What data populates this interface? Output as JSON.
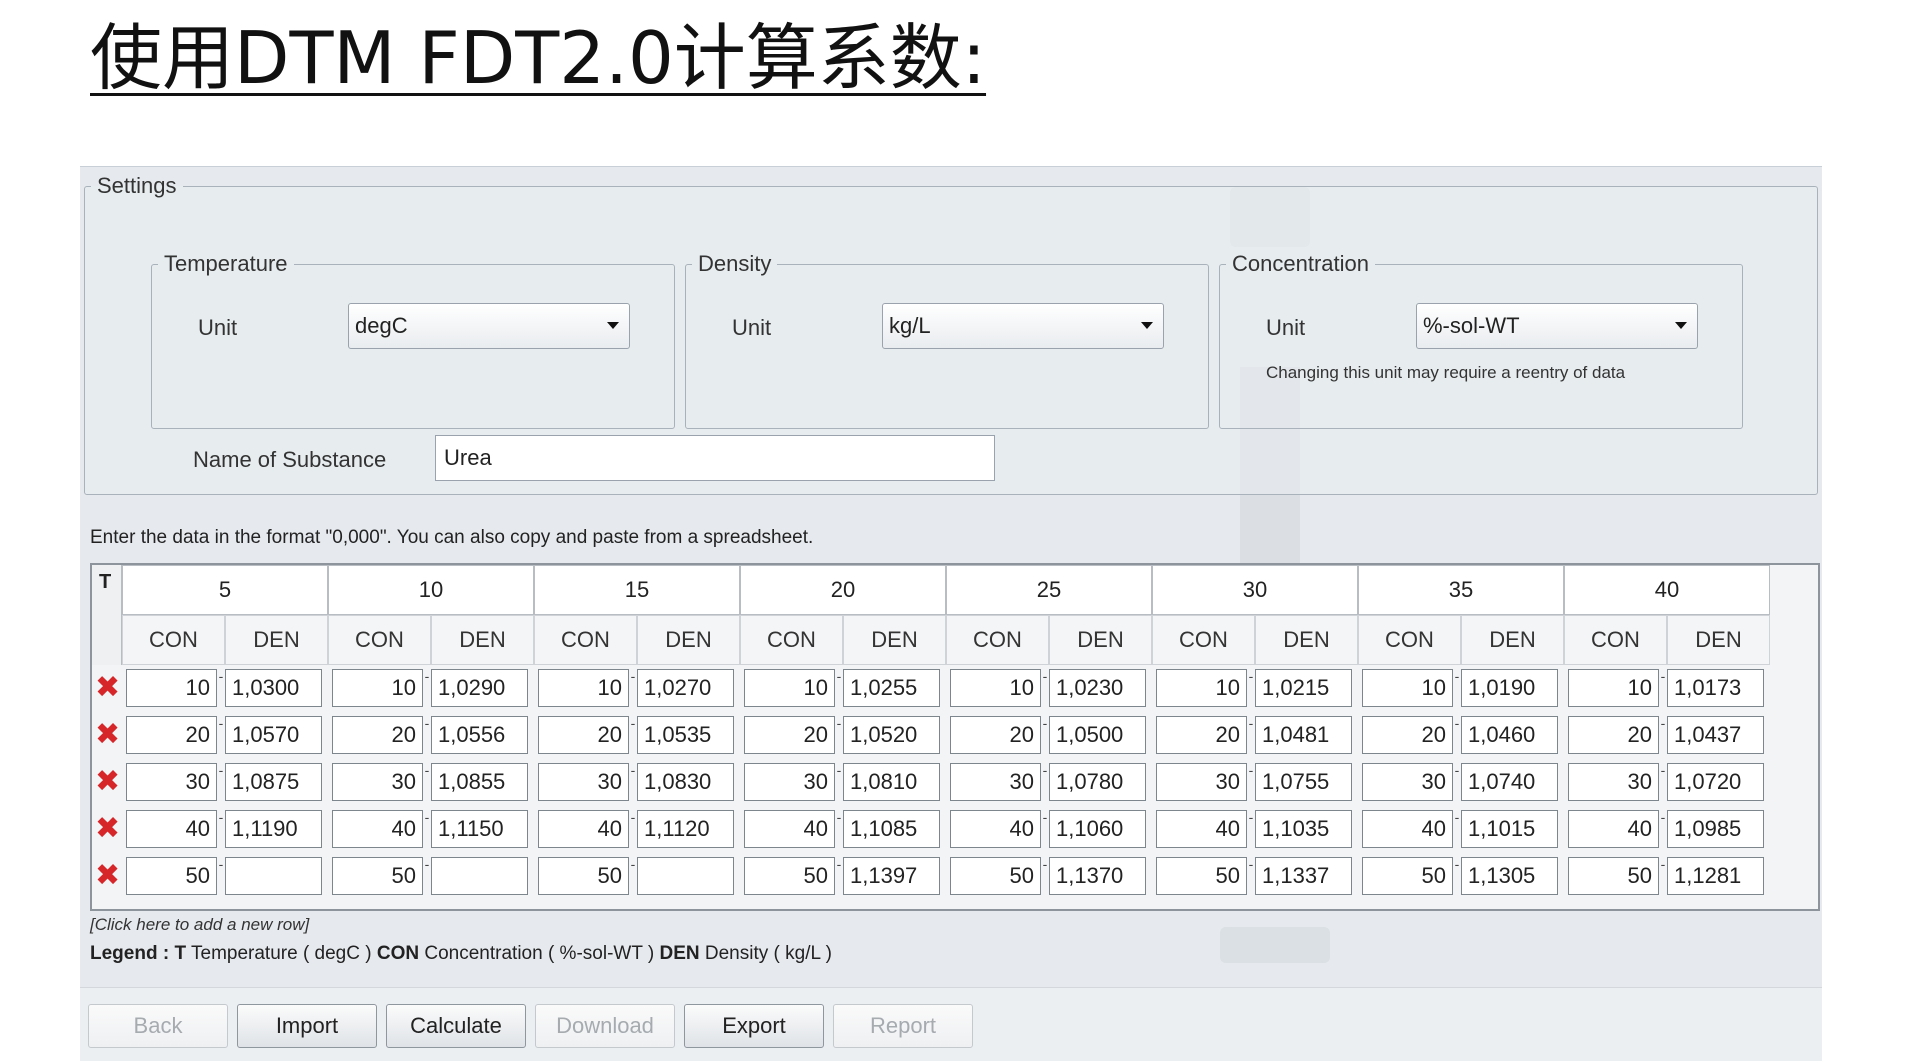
{
  "page": {
    "title": "使用DTM FDT2.0计算系数:"
  },
  "settings": {
    "legend": "Settings",
    "temperature": {
      "legend": "Temperature",
      "unit_label": "Unit",
      "unit_value": "degC"
    },
    "density": {
      "legend": "Density",
      "unit_label": "Unit",
      "unit_value": "kg/L"
    },
    "concentration": {
      "legend": "Concentration",
      "unit_label": "Unit",
      "unit_value": "%-sol-WT",
      "hint": "Changing this unit may require a reentry of data"
    },
    "substance": {
      "label": "Name of Substance",
      "value": "Urea"
    }
  },
  "table": {
    "instruction": "Enter the data in the format \"0,000\". You can also copy and paste from a spreadsheet.",
    "t_header": "T",
    "con_header": "CON",
    "den_header": "DEN",
    "temperatures": [
      "5",
      "10",
      "15",
      "20",
      "25",
      "30",
      "35",
      "40"
    ],
    "concentrations": [
      "10",
      "20",
      "30",
      "40",
      "50"
    ],
    "densities": [
      [
        "1,0300",
        "1,0570",
        "1,0875",
        "1,1190",
        ""
      ],
      [
        "1,0290",
        "1,0556",
        "1,0855",
        "1,1150",
        ""
      ],
      [
        "1,0270",
        "1,0535",
        "1,0830",
        "1,1120",
        ""
      ],
      [
        "1,0255",
        "1,0520",
        "1,0810",
        "1,1085",
        "1,1397"
      ],
      [
        "1,0230",
        "1,0500",
        "1,0780",
        "1,1060",
        "1,1370"
      ],
      [
        "1,0215",
        "1,0481",
        "1,0755",
        "1,1035",
        "1,1337"
      ],
      [
        "1,0190",
        "1,0460",
        "1,0740",
        "1,1015",
        "1,1305"
      ],
      [
        "1,0173",
        "1,0437",
        "1,0720",
        "1,0985",
        "1,1281"
      ]
    ],
    "delete_glyph": "✖",
    "add_row": "[Click here to add a new row]"
  },
  "legend_line": {
    "prefix": "Legend :",
    "t_key": "T",
    "t_text": "Temperature ( degC )",
    "con_key": "CON",
    "con_text": "Concentration ( %-sol-WT )",
    "den_key": "DEN",
    "den_text": "Density ( kg/L )"
  },
  "buttons": {
    "back": "Back",
    "import": "Import",
    "calculate": "Calculate",
    "download": "Download",
    "export": "Export",
    "report": "Report"
  }
}
